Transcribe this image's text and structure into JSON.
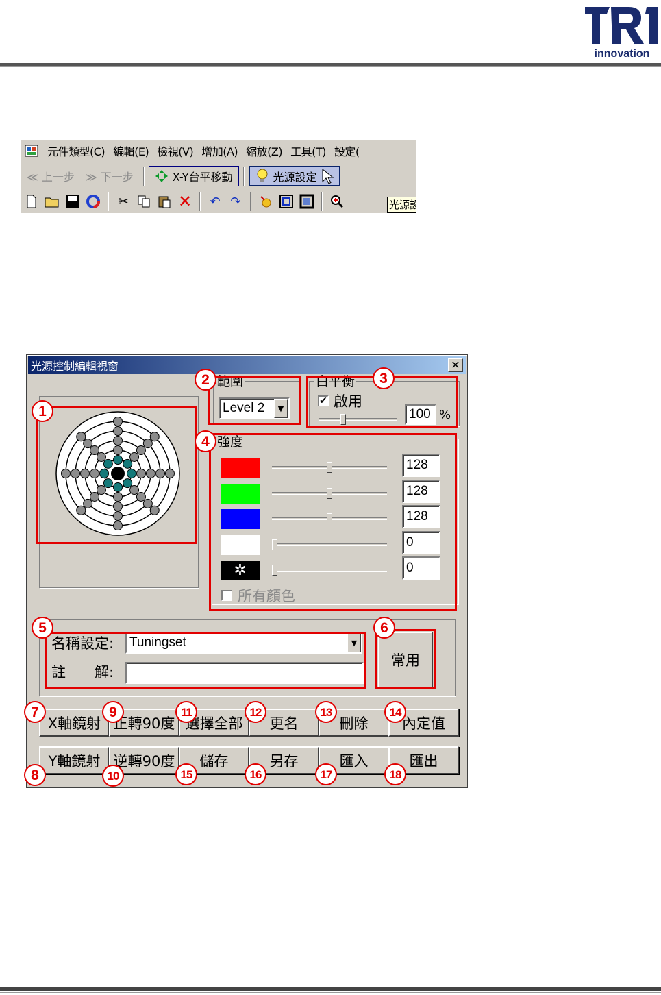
{
  "logo": {
    "letters": "TRI",
    "subtitle": "innovation"
  },
  "toolbar": {
    "menu": [
      "元件類型(C)",
      "編輯(E)",
      "檢視(V)",
      "增加(A)",
      "縮放(Z)",
      "工具(T)",
      "設定("
    ],
    "back_label": "≪ 上一步",
    "forward_label": "≫ 下一步",
    "xy_move_label": "X-Y台平移動",
    "light_setting_label": "光源設定",
    "tooltip": "光源設"
  },
  "dialog": {
    "title": "光源控制編輯視窗",
    "close_glyph": "✕",
    "range": {
      "label": "範圍",
      "value": "Level 2"
    },
    "white_balance": {
      "label": "白平衡",
      "enable_label": "啟用",
      "enabled": true,
      "value": "100",
      "unit": "%",
      "slider_fraction": 0.3
    },
    "intensity": {
      "label": "強度",
      "channels": [
        {
          "name": "red",
          "color": "#ff0000",
          "value": "128",
          "fraction": 0.5
        },
        {
          "name": "green",
          "color": "#00ff00",
          "value": "128",
          "fraction": 0.5
        },
        {
          "name": "blue",
          "color": "#0000ff",
          "value": "128",
          "fraction": 0.5
        },
        {
          "name": "white",
          "color": "#ffffff",
          "value": "0",
          "fraction": 0.0
        },
        {
          "name": "sun",
          "color": "#000000",
          "value": "0",
          "fraction": 0.0
        }
      ],
      "all_colors_label": "所有顏色"
    },
    "name_setting": {
      "label": "名稱設定:",
      "value": "Tuningset"
    },
    "comment": {
      "label": "註　　解:",
      "value": ""
    },
    "common_button": "常用",
    "buttons_row1": [
      "X軸鏡射",
      "正轉90度",
      "選擇全部",
      "更名",
      "刪除",
      "內定值"
    ],
    "buttons_row2": [
      "Y軸鏡射",
      "逆轉90度",
      "儲存",
      "另存",
      "匯入",
      "匯出"
    ],
    "badges": [
      "1",
      "2",
      "3",
      "4",
      "5",
      "6",
      "7",
      "8",
      "9",
      "10",
      "11",
      "12",
      "13",
      "14",
      "15",
      "16",
      "17",
      "18"
    ]
  },
  "colors": {
    "annotation_red": "#e20000",
    "titlebar": "#0a246a",
    "window_face": "#d4d0c8",
    "led_teal": "#147a7a"
  }
}
